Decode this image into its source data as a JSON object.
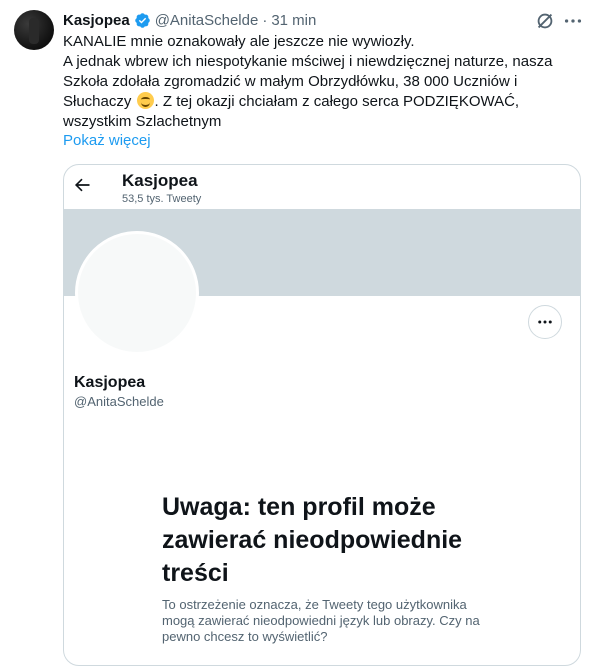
{
  "tweet": {
    "author_name": "Kasjopea",
    "author_handle": "@AnitaSchelde",
    "separator": "·",
    "time": "31 min",
    "line1": "KANALIE mnie oznakowały ale jeszcze nie wywiozły.",
    "line2_before_emoji": "A jednak wbrew ich niespotykanie mściwej i niewdzięcznej naturze, nasza Szkoła zdołała zgromadzić w małym Obrzydłówku, 38 000 Uczniów i Słuchaczy",
    "line2_after_emoji": ". Z tej okazji chciałam z całego serca PODZIĘKOWAĆ, wszystkim Szlachetnym",
    "show_more": "Pokaż więcej",
    "emoji_icon": "smiling-face-emoji",
    "verified_color": "#1d9bf0"
  },
  "card": {
    "name": "Kasjopea",
    "tweet_count": "53,5 tys. Tweety",
    "profile_name": "Kasjopea",
    "profile_handle": "@AnitaSchelde",
    "warning_title": "Uwaga: ten profil może zawierać nieodpowiednie treści",
    "warning_text": "To ostrzeżenie oznacza, że Tweety tego użytkownika mogą zawierać nieodpowiedni język lub obrazy. Czy na pewno chcesz to wyświetlić?",
    "banner_color": "#cfd9de"
  },
  "colors": {
    "accent": "#1d9bf0",
    "text": "#0f1419",
    "secondary": "#536471"
  }
}
